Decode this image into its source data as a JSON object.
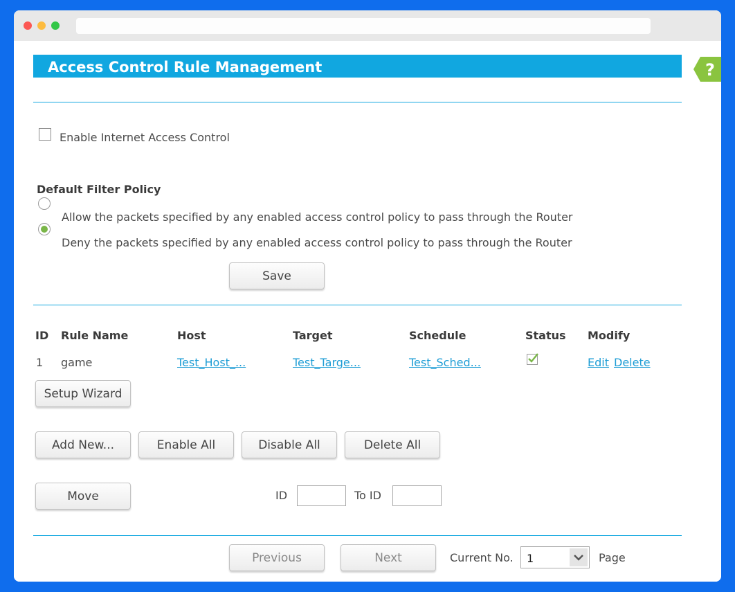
{
  "page": {
    "title": "Access Control Rule Management",
    "help_icon": "question-mark-icon"
  },
  "access_control": {
    "enable_label": "Enable Internet Access Control",
    "enabled": false
  },
  "filter_policy": {
    "heading": "Default Filter Policy",
    "options": [
      {
        "label": "Allow the packets specified by any enabled access control policy to pass through the Router",
        "selected": false
      },
      {
        "label": "Deny the packets specified by any enabled access control policy to pass through the Router",
        "selected": true
      }
    ],
    "save_label": "Save"
  },
  "rules_table": {
    "columns": [
      "ID",
      "Rule Name",
      "Host",
      "Target",
      "Schedule",
      "Status",
      "Modify"
    ],
    "rows": [
      {
        "id": "1",
        "rule_name": "game",
        "host": "Test_Host_...",
        "target": "Test_Targe...",
        "schedule": "Test_Sched...",
        "status_icon": "checkmark-icon",
        "edit": "Edit",
        "delete": "Delete"
      }
    ]
  },
  "actions": {
    "setup_wizard": "Setup Wizard",
    "add_new": "Add New...",
    "enable_all": "Enable All",
    "disable_all": "Disable All",
    "delete_all": "Delete All",
    "move": "Move",
    "id_label": "ID",
    "to_id_label": "To ID",
    "id_value": "",
    "to_id_value": ""
  },
  "pagination": {
    "previous": "Previous",
    "next": "Next",
    "current_no_label": "Current No.",
    "current_value": "1",
    "page_label": "Page"
  },
  "colors": {
    "accent": "#11a7e0",
    "link": "#1e9dd5",
    "radio_selected": "#7ab648",
    "help_tab": "#8ac43f",
    "background": "#0f6ded"
  }
}
